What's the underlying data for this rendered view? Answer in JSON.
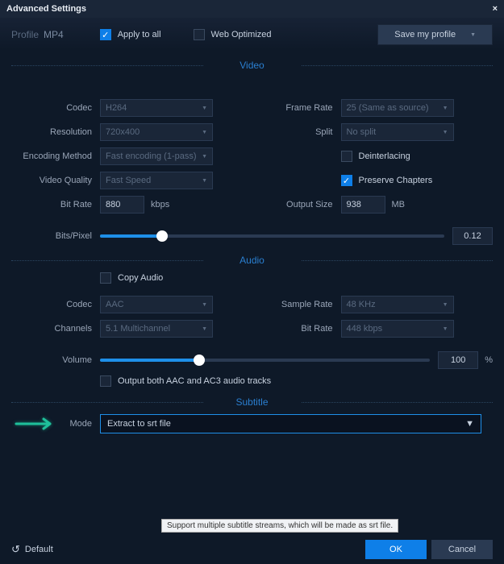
{
  "title": "Advanced Settings",
  "profile": {
    "label": "Profile",
    "value": "MP4"
  },
  "applyAll": {
    "label": "Apply to all",
    "checked": true
  },
  "webOpt": {
    "label": "Web Optimized",
    "checked": false
  },
  "saveProfile": "Save my profile",
  "sections": {
    "video": "Video",
    "audio": "Audio",
    "subtitle": "Subtitle"
  },
  "video": {
    "codec": {
      "label": "Codec",
      "value": "H264"
    },
    "frameRate": {
      "label": "Frame Rate",
      "value": "25 (Same as source)"
    },
    "resolution": {
      "label": "Resolution",
      "value": "720x400"
    },
    "split": {
      "label": "Split",
      "value": "No split"
    },
    "encoding": {
      "label": "Encoding Method",
      "value": "Fast encoding (1-pass)"
    },
    "deinterlace": {
      "label": "Deinterlacing",
      "checked": false
    },
    "quality": {
      "label": "Video Quality",
      "value": "Fast Speed"
    },
    "preserve": {
      "label": "Preserve Chapters",
      "checked": true
    },
    "bitrate": {
      "label": "Bit Rate",
      "value": "880",
      "unit": "kbps"
    },
    "outputSize": {
      "label": "Output Size",
      "value": "938",
      "unit": "MB"
    },
    "bitsPixel": {
      "label": "Bits/Pixel",
      "value": "0.12",
      "pct": 18
    }
  },
  "audio": {
    "copy": {
      "label": "Copy Audio",
      "checked": false
    },
    "codec": {
      "label": "Codec",
      "value": "AAC"
    },
    "sampleRate": {
      "label": "Sample Rate",
      "value": "48 KHz"
    },
    "channels": {
      "label": "Channels",
      "value": "5.1 Multichannel"
    },
    "bitrate": {
      "label": "Bit Rate",
      "value": "448 kbps"
    },
    "volume": {
      "label": "Volume",
      "value": "100",
      "unit": "%",
      "pct": 30
    },
    "outputBoth": {
      "label": "Output both AAC and AC3 audio tracks",
      "checked": false
    }
  },
  "subtitle": {
    "mode": {
      "label": "Mode",
      "value": "Extract to srt file"
    },
    "tooltip": "Support multiple subtitle streams, which will be made as srt file."
  },
  "footer": {
    "default": "Default",
    "ok": "OK",
    "cancel": "Cancel"
  }
}
